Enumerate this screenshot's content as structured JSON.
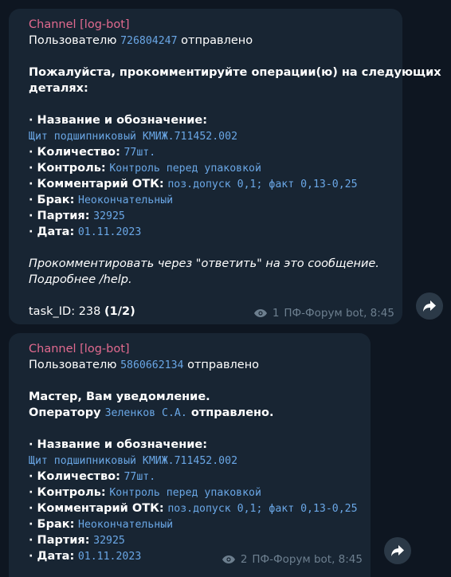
{
  "messages": [
    {
      "channel": "Channel [log-bot]",
      "to_prefix": "Пользователю ",
      "user_id": "726804247",
      "to_suffix": " отправлено",
      "intro1": "Пожалуйста, прокомментируйте операции(ю) на следующих",
      "intro2": "деталях:",
      "name_label": "· Название и обозначение:",
      "name_value": "Щит подшипниковый КМИЖ.711452.002",
      "qty_label": "· Количество:",
      "qty_value": "77шт.",
      "control_label": "· Контроль:",
      "control_value": "Контроль перед упаковкой",
      "comment_label": "· Комментарий ОТК:",
      "comment_value": "поз.допуск 0,1; факт 0,13-0,25",
      "defect_label": "· Брак:",
      "defect_value": "Неокончательный",
      "batch_label": "· Партия:",
      "batch_value": "32925",
      "date_label": "· Дата:",
      "date_value": "01.11.2023",
      "hint1": "Прокомментировать через \"ответить\" на это сообщение.",
      "hint2": "Подробнее /help.",
      "task_prefix": "task_ID: 238 ",
      "task_part": "(1/2)",
      "views": "1",
      "sender_time": "ПФ-Форум bot, 8:45"
    },
    {
      "channel": "Channel [log-bot]",
      "to_prefix": "Пользователю ",
      "user_id": "5860662134",
      "to_suffix": " отправлено",
      "notice": "Мастер, Вам уведомление.",
      "operator_prefix": "Оператору ",
      "operator_name": "Зеленков С.А.",
      "operator_suffix": " отправлено.",
      "name_label": "· Название и обозначение:",
      "name_value": "Щит подшипниковый КМИЖ.711452.002",
      "qty_label": "· Количество:",
      "qty_value": "77шт.",
      "control_label": "· Контроль:",
      "control_value": "Контроль перед упаковкой",
      "comment_label": "· Комментарий ОТК:",
      "comment_value": "поз.допуск 0,1; факт 0,13-0,25",
      "defect_label": "· Брак:",
      "defect_value": "Неокончательный",
      "batch_label": "· Партия:",
      "batch_value": "32925",
      "date_label": "· Дата:",
      "date_value": "01.11.2023",
      "views": "2",
      "sender_time": "ПФ-Форум bot, 8:45"
    }
  ],
  "icons": {
    "views": "eye-icon",
    "share": "share-arrow-icon"
  },
  "colors": {
    "background": "#0e1621",
    "bubble": "#182533",
    "channel_name": "#e16a8f",
    "mono_text": "#6aa7e6",
    "meta_text": "#6d7f8f"
  }
}
